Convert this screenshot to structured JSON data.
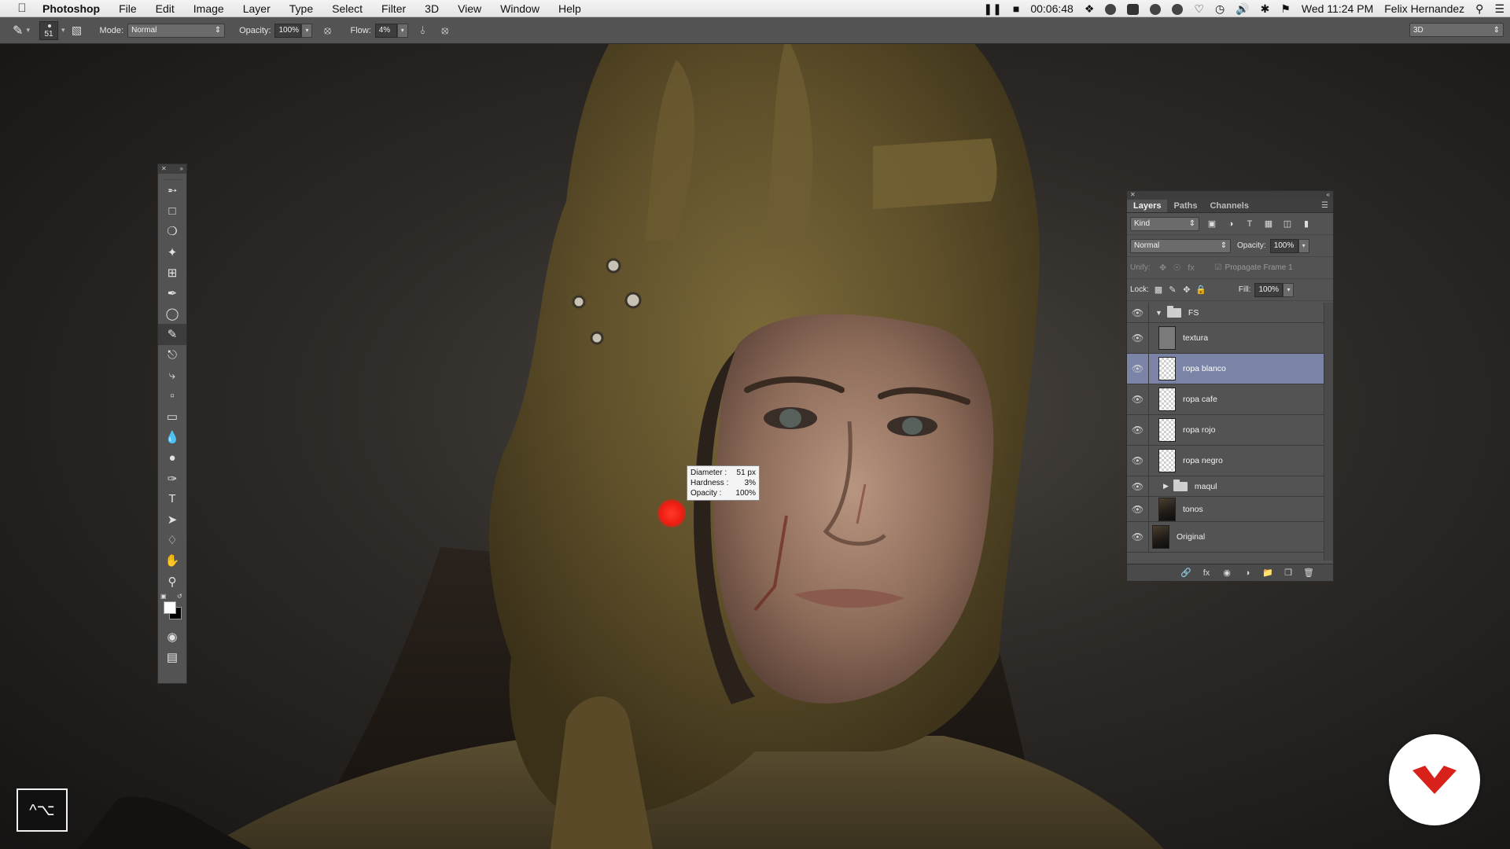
{
  "menubar": {
    "app_name": "Photoshop",
    "menus": [
      "File",
      "Edit",
      "Image",
      "Layer",
      "Type",
      "Select",
      "Filter",
      "3D",
      "View",
      "Window",
      "Help"
    ],
    "recording_time": "00:06:48",
    "datetime": "Wed 11:24 PM",
    "user": "Felix Hernandez"
  },
  "options_bar": {
    "brush_size": "51",
    "mode_label": "Mode:",
    "mode_value": "Normal",
    "opacity_label": "Opacity:",
    "opacity_value": "100%",
    "flow_label": "Flow:",
    "flow_value": "4%",
    "workspace": "3D"
  },
  "brush_tooltip": {
    "diameter_label": "Diameter :",
    "diameter_value": "51 px",
    "hardness_label": "Hardness :",
    "hardness_value": "3%",
    "opacity_label": "Opacity :",
    "opacity_value": "100%"
  },
  "layers_panel": {
    "tabs": [
      "Layers",
      "Paths",
      "Channels"
    ],
    "filter_kind": "Kind",
    "blend_mode": "Normal",
    "opacity_label": "Opacity:",
    "opacity_value": "100%",
    "unify_label": "Unify:",
    "propagate_label": "Propagate Frame 1",
    "lock_label": "Lock:",
    "fill_label": "Fill:",
    "fill_value": "100%",
    "layers": [
      {
        "name": "FS",
        "kind": "group-open"
      },
      {
        "name": "textura",
        "kind": "layer"
      },
      {
        "name": "ropa blanco",
        "kind": "layer",
        "selected": true
      },
      {
        "name": "ropa cafe",
        "kind": "layer"
      },
      {
        "name": "ropa rojo",
        "kind": "layer"
      },
      {
        "name": "ropa negro",
        "kind": "layer"
      },
      {
        "name": "maqul",
        "kind": "group-closed"
      },
      {
        "name": "tonos",
        "kind": "layer"
      },
      {
        "name": "Original",
        "kind": "layer"
      }
    ]
  },
  "keys_hud": "^⌥",
  "colors": {
    "selected_layer": "#7b84a6",
    "brush_cursor": "#ef1c12",
    "badge_mark": "#d9211c"
  }
}
